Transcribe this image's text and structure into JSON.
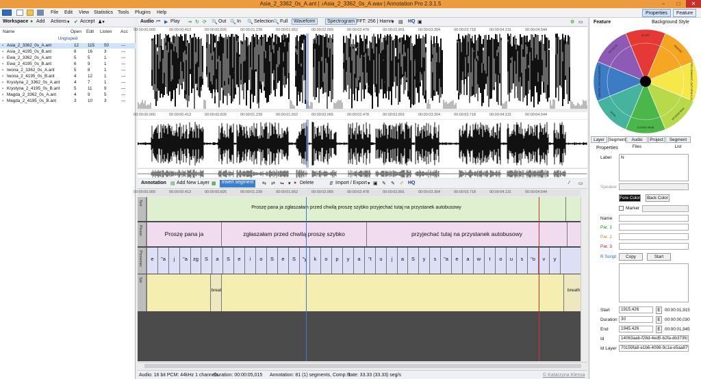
{
  "window": {
    "title": "Asia_2_3362_0s_A.ant | ♪Asia_2_3362_0s_A.wav | Annotation Pro 2.3.1.5"
  },
  "menu": [
    "File",
    "Edit",
    "View",
    "Statistics",
    "Tools",
    "Plugins",
    "Help"
  ],
  "ribbon_buttons": {
    "properties": "Properties",
    "feature": "Feature"
  },
  "workspace": {
    "title": "Workspace",
    "add": "Add",
    "actions": "Actions",
    "accept": "Accept",
    "columns": [
      "Name",
      "Open",
      "Edit",
      "Listen",
      "Acc"
    ],
    "group": "Ungruped",
    "files": [
      {
        "name": "Asia_2_3362_0s_A.ant",
        "open": "12",
        "edit": "115",
        "listen": "50",
        "acc": "---"
      },
      {
        "name": "Asia_2_4195_0s_B.ant",
        "open": "8",
        "edit": "16",
        "listen": "3",
        "acc": "---"
      },
      {
        "name": "Ewa_2_3362_0s_A.ant",
        "open": "5",
        "edit": "5",
        "listen": "1",
        "acc": "---"
      },
      {
        "name": "Ewa_2_4195_0s_B.ant",
        "open": "6",
        "edit": "9",
        "listen": "1",
        "acc": "---"
      },
      {
        "name": "Iwona_2_3362_0s_A.ant",
        "open": "5",
        "edit": "8",
        "listen": "1",
        "acc": "---"
      },
      {
        "name": "Iwona_2_4195_0s_B.ant",
        "open": "4",
        "edit": "12",
        "listen": "1",
        "acc": "---"
      },
      {
        "name": "Krystyna_2_3362_0s_A.ant",
        "open": "4",
        "edit": "7",
        "listen": "1",
        "acc": "---"
      },
      {
        "name": "Krystyna_2_4195_0s_B.ant",
        "open": "5",
        "edit": "11",
        "listen": "9",
        "acc": "---"
      },
      {
        "name": "Magda_2_3362_0s_A.ant",
        "open": "4",
        "edit": "9",
        "listen": "5",
        "acc": "---"
      },
      {
        "name": "Magda_2_4195_0s_B.ant",
        "open": "3",
        "edit": "10",
        "listen": "3",
        "acc": "---"
      }
    ]
  },
  "audio": {
    "label": "Audio",
    "play": "Play",
    "out": "Out",
    "in": "In",
    "selection": "Selection",
    "full": "Full",
    "waveform": "Waveform",
    "spectrogram": "Spectrogram",
    "fft": "FFT: 256 | Hamm",
    "hq": "HQ",
    "ticks": [
      "00:00:00.000",
      "00:00:00.413",
      "00:00:00.826",
      "00:00:01.239",
      "00:00:01.652",
      "00:00:02.065",
      "00:00:02.478",
      "00:00:02.891",
      "00:00:03.304",
      "00:00:03.718",
      "00:00:04.131",
      "00:00:04.544"
    ]
  },
  "annotation": {
    "label": "Annotation",
    "add_layer": "Add New Layer",
    "insert_segment": "Insert segment",
    "delete": "Delete",
    "import_export": "Import / Export",
    "hq": "HQ",
    "layers": [
      {
        "name": "Text",
        "segments": [
          "Proszę pana ja zgłaszałam przed chwilą proszę szybko przyjechać tutaj na przystanek autobusowy"
        ]
      },
      {
        "name": "Phrase",
        "segments": [
          "Proszę pana ja",
          "zgłaszałam przed chwilą proszę szybko",
          "przyjechać tutaj na przystanek autobusowy"
        ]
      },
      {
        "name": "Phonemes",
        "segments": [
          "e",
          "\"a",
          "j",
          "\"a",
          "zg",
          "S",
          "a",
          "S",
          "e",
          "i",
          "o",
          "S",
          "e",
          "S",
          "\"y",
          "k",
          "o",
          "p",
          "y",
          "a",
          "\"t",
          "u",
          "j",
          "a",
          "S",
          "y",
          "s",
          "\"a",
          "e",
          "a",
          "w",
          "t",
          "o",
          "u",
          "s",
          "\"o",
          "v",
          "y"
        ]
      },
      {
        "name": "Spk",
        "segments": [
          "breath",
          "breath"
        ]
      }
    ]
  },
  "status": {
    "audio": "Audio: 16 bit PCM: 44kHz 1 channels",
    "duration": "Duration: 00:00:05,015",
    "annotation": "Annotation: 81 (1) segments, Comp: 1",
    "rate": "Rate: 33.33 (33.33) seg/s",
    "credit": "© Katarzyna Klessa"
  },
  "feature": {
    "title": "Feature",
    "background_style": "Background Style",
    "wheel_labels": [
      "ZŁOŚĆ",
      "RADOŚĆ",
      "PRZYJEMNOŚĆ (SATYSFAKCJA)",
      "INNA EMOCJA",
      "BRAK EMOCJI",
      "NUDA",
      "SMUTEK (PRZYGNĘBIENIE)",
      "IRYTACJA"
    ],
    "wheel_colors": [
      "#e53935",
      "#f5a623",
      "#f7e84a",
      "#b8d94a",
      "#4bb64a",
      "#45b39d",
      "#3c7cc4",
      "#8d5bb5"
    ]
  },
  "properties": {
    "tabs": [
      "Layer",
      "Segment",
      "Audio Files",
      "Project",
      "Segment List"
    ],
    "active_tab": "Segment",
    "title": "Properties",
    "label_label": "Label",
    "label_value": "N",
    "speaker_label": "Speaker",
    "fore_color": "Fore Color",
    "back_color": "Back Color",
    "marker": "Marker",
    "name": "Name",
    "par1": "Par. 1",
    "par2": "Par. 2",
    "par3": "Par. 3",
    "rscript": "R Script",
    "copy": "Copy",
    "start_btn": "Start",
    "start_label": "Start",
    "start_value": "1915.426",
    "start_time": "00:00:01,915",
    "duration_label": "Duration",
    "duration_value": "30",
    "duration_time": "00:00:00,030",
    "end_label": "End",
    "end_value": "1945.426",
    "end_time": "00:00:01,945",
    "id_label": "Id",
    "id_value": "14063aab-f28d-4ed5-b2fa-db373fcf80a",
    "idlayer_label": "Id Layer",
    "idlayer_value": "70159fa8-e1b6-4098-9c1a-e5aa8794c1",
    "e": "E"
  }
}
